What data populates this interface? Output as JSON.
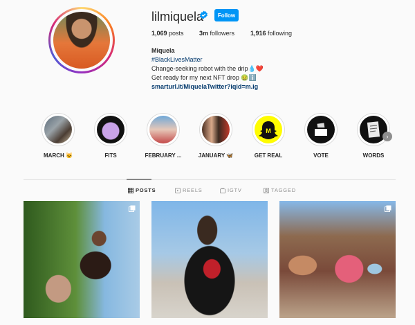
{
  "profile": {
    "username": "lilmiquela",
    "follow_label": "Follow",
    "stats": {
      "posts_count": "1,069",
      "posts_label": " posts",
      "followers_count": "3m",
      "followers_label": " followers",
      "following_count": "1,916",
      "following_label": " following"
    },
    "bio": {
      "name": "Miquela",
      "hashtag": "#BlackLivesMatter",
      "line1": "Change-seeking robot with the drip💧❤️",
      "line2": "Get ready for my next NFT drop 🤢ℹ️",
      "link": "smarturl.it/MiquelaTwitter?iqid=m.ig"
    }
  },
  "highlights": [
    {
      "label": "MARCH 🐱"
    },
    {
      "label": "FITS"
    },
    {
      "label": "FEBRUARY ..."
    },
    {
      "label": "JANUARY 🦋"
    },
    {
      "label": "GET REAL"
    },
    {
      "label": "VOTE"
    },
    {
      "label": "WORDS"
    }
  ],
  "tabs": [
    {
      "label": "POSTS",
      "icon": "grid-icon",
      "active": true
    },
    {
      "label": "REELS",
      "icon": "reels-icon"
    },
    {
      "label": "IGTV",
      "icon": "igtv-icon"
    },
    {
      "label": "TAGGED",
      "icon": "tagged-icon"
    }
  ],
  "colors": {
    "accent": "#0095f6",
    "link": "#00376b",
    "text": "#262626",
    "muted": "#8e8e8e"
  }
}
